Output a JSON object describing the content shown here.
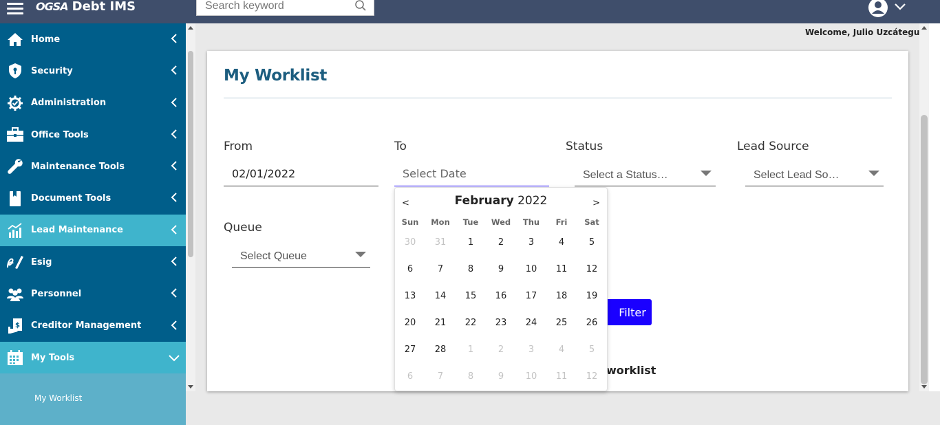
{
  "header": {
    "logo_mark": "OGSA",
    "app_name": "Debt IMS",
    "search_placeholder": "Search keyword"
  },
  "welcome": "Welcome, Julio Uzcátegui",
  "sidebar": {
    "items": [
      {
        "label": "Home",
        "icon": "home-icon"
      },
      {
        "label": "Security",
        "icon": "shield-icon"
      },
      {
        "label": "Administration",
        "icon": "gear-icon"
      },
      {
        "label": "Office Tools",
        "icon": "briefcase-icon"
      },
      {
        "label": "Maintenance Tools",
        "icon": "wrench-icon"
      },
      {
        "label": "Document Tools",
        "icon": "document-icon"
      },
      {
        "label": "Lead Maintenance",
        "icon": "chart-icon"
      },
      {
        "label": "Esig",
        "icon": "signature-icon"
      },
      {
        "label": "Personnel",
        "icon": "people-icon"
      },
      {
        "label": "Creditor Management",
        "icon": "creditor-icon"
      },
      {
        "label": "My Tools",
        "icon": "calendar-icon"
      }
    ],
    "sub_items": [
      "My Worklist"
    ]
  },
  "main": {
    "title": "My Worklist",
    "from_label": "From",
    "from_value": "02/01/2022",
    "to_label": "To",
    "to_placeholder": "Select Date",
    "status_label": "Status",
    "status_placeholder": "Select a Status…",
    "lead_source_label": "Lead Source",
    "lead_source_placeholder": "Select Lead So…",
    "queue_label": "Queue",
    "queue_placeholder": "Select Queue",
    "filter_label": "Filter",
    "worklist_text": "worklist"
  },
  "calendar": {
    "prev": "<",
    "next": ">",
    "month": "February",
    "year": "2022",
    "weekdays": [
      "Sun",
      "Mon",
      "Tue",
      "Wed",
      "Thu",
      "Fri",
      "Sat"
    ],
    "weeks": [
      [
        {
          "d": "30",
          "m": true
        },
        {
          "d": "31",
          "m": true
        },
        {
          "d": "1"
        },
        {
          "d": "2"
        },
        {
          "d": "3"
        },
        {
          "d": "4"
        },
        {
          "d": "5"
        }
      ],
      [
        {
          "d": "6"
        },
        {
          "d": "7"
        },
        {
          "d": "8"
        },
        {
          "d": "9"
        },
        {
          "d": "10"
        },
        {
          "d": "11"
        },
        {
          "d": "12"
        }
      ],
      [
        {
          "d": "13"
        },
        {
          "d": "14"
        },
        {
          "d": "15"
        },
        {
          "d": "16"
        },
        {
          "d": "17"
        },
        {
          "d": "18"
        },
        {
          "d": "19"
        }
      ],
      [
        {
          "d": "20"
        },
        {
          "d": "21"
        },
        {
          "d": "22"
        },
        {
          "d": "23"
        },
        {
          "d": "24"
        },
        {
          "d": "25"
        },
        {
          "d": "26"
        }
      ],
      [
        {
          "d": "27"
        },
        {
          "d": "28"
        },
        {
          "d": "1",
          "m": true
        },
        {
          "d": "2",
          "m": true
        },
        {
          "d": "3",
          "m": true
        },
        {
          "d": "4",
          "m": true
        },
        {
          "d": "5",
          "m": true
        }
      ],
      [
        {
          "d": "6",
          "m": true
        },
        {
          "d": "7",
          "m": true
        },
        {
          "d": "8",
          "m": true
        },
        {
          "d": "9",
          "m": true
        },
        {
          "d": "10",
          "m": true
        },
        {
          "d": "11",
          "m": true
        },
        {
          "d": "12",
          "m": true
        }
      ]
    ]
  },
  "colors": {
    "topbar": "#3f4e6b",
    "sidebar": "#005e8a",
    "sidebar_active": "#3fb4cc",
    "title": "#1c5d7f",
    "filter_button": "#1a00ff"
  }
}
